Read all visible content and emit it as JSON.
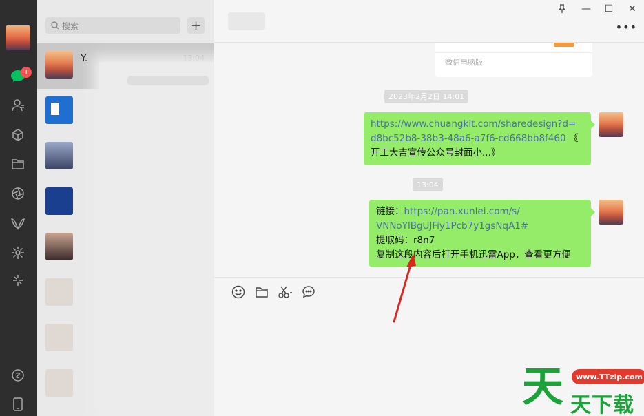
{
  "search": {
    "placeholder": "搜索",
    "add": "+"
  },
  "rail": {
    "unread_count": "1"
  },
  "chat_list": [
    {
      "name": "Y.",
      "time": "13:04"
    }
  ],
  "window": {
    "pin": "⊥",
    "minimize": "—",
    "maximize": "☐",
    "close": "✕",
    "more": "•••"
  },
  "messages": {
    "card_source": "微信电脑版",
    "stamp1": "2023年2月2日 14:01",
    "msg1_link_line1": "https://www.chuangkit.com/sharedesign?d=",
    "msg1_link_line2": "d8bc52b8-38b3-48a6-a7f6-cd668bb8f460",
    "msg1_tail_line2": " 《",
    "msg1_line3": "开工大吉宣传公众号封面小...》",
    "stamp2": "13:04",
    "msg2_label": "链接：",
    "msg2_link_line1": "https://pan.xunlei.com/s/",
    "msg2_link_line2": "VNNoYlBgUJFiy1Pcb7y1gsNqA1#",
    "msg2_code": "提取码：r8n7",
    "msg2_tip": "复制这段内容后打开手机迅雷App，查看更方便"
  },
  "watermark": {
    "char": "天",
    "url": "www.TTzip.com",
    "text": "天下载"
  },
  "colors": {
    "bubble": "#95ec69",
    "rail": "#2e2e2e",
    "link": "#4a6fa5",
    "arrow": "#d8281f",
    "watermark_green": "#1ba33a"
  }
}
